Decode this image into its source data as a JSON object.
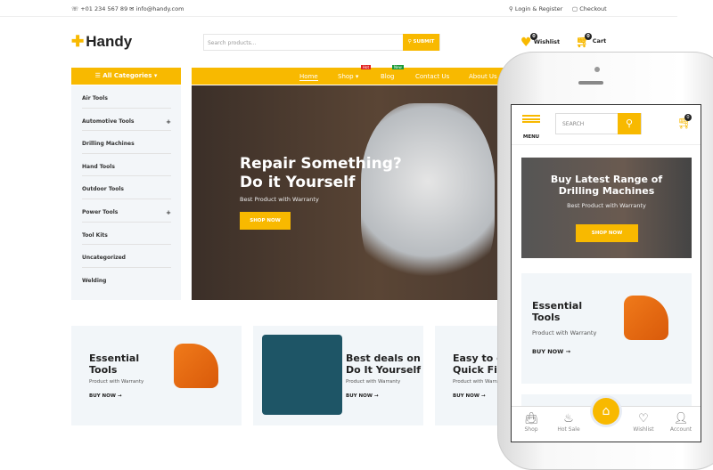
{
  "topbar": {
    "phone": "+01 234 567 89",
    "email": "info@handy.com",
    "login": "Login & Register",
    "checkout": "Checkout"
  },
  "header": {
    "logo": "Handy",
    "search_placeholder": "Search products...",
    "search_button": "SUBMIT",
    "wishlist_label": "Wishlist",
    "wishlist_count": "0",
    "cart_label": "Cart",
    "cart_count": "0"
  },
  "categories": {
    "title": "All Categories",
    "items": [
      {
        "label": "Air Tools",
        "plus": ""
      },
      {
        "label": "Automotive Tools",
        "plus": "+"
      },
      {
        "label": "Drilling Machines",
        "plus": ""
      },
      {
        "label": "Hand Tools",
        "plus": ""
      },
      {
        "label": "Outdoor Tools",
        "plus": ""
      },
      {
        "label": "Power Tools",
        "plus": "+"
      },
      {
        "label": "Tool Kits",
        "plus": ""
      },
      {
        "label": "Uncategorized",
        "plus": ""
      },
      {
        "label": "Welding",
        "plus": ""
      }
    ]
  },
  "nav": {
    "items": [
      "Home",
      "Shop",
      "Blog",
      "Contact Us",
      "About Us"
    ],
    "hot": "Hot",
    "new": "New"
  },
  "hero": {
    "title_line1": "Repair Something?",
    "title_line2": "Do it Yourself",
    "subtitle": "Best Product with Warranty",
    "button": "SHOP NOW"
  },
  "cards": [
    {
      "title1": "Essential",
      "title2": "Tools",
      "sub": "Product with Warranty",
      "buy": "BUY NOW →"
    },
    {
      "title1": "Best deals on",
      "title2": "Do It Yourself",
      "sub": "Product with Warranty",
      "buy": "BUY NOW →"
    },
    {
      "title1": "Easy to do",
      "title2": "Quick Fix",
      "sub": "Product with Warranty",
      "buy": "BUY NOW →"
    }
  ],
  "mobile": {
    "menu": "MENU",
    "search_placeholder": "SEARCH",
    "cart_count": "0",
    "hero_title1": "Buy Latest Range of",
    "hero_title2": "Drilling Machines",
    "hero_sub": "Best Product with Warranty",
    "hero_button": "SHOP NOW",
    "card_title1": "Essential",
    "card_title2": "Tools",
    "card_sub": "Product with Warranty",
    "card_buy": "BUY NOW →",
    "nav": [
      "Shop",
      "Hot Sale",
      "Wishlist",
      "Account"
    ]
  },
  "colors": {
    "accent": "#f8b900",
    "card_bg": "#f2f6f9",
    "hot": "#e02020",
    "new": "#1a9a3a"
  }
}
